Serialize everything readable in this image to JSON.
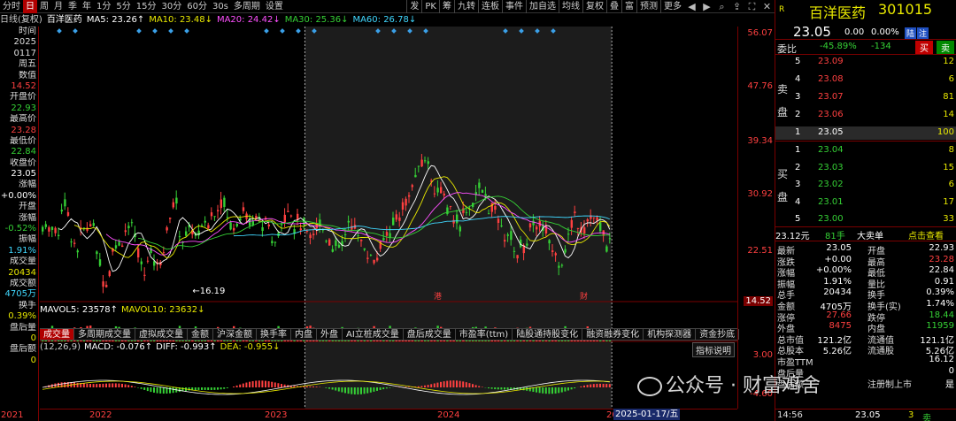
{
  "topbar": {
    "left_items": [
      "分时",
      "日",
      "周",
      "月",
      "季",
      "年",
      "1分",
      "5分",
      "15分",
      "30分",
      "60分",
      "30s",
      "多周期",
      "设置"
    ],
    "active_index": 1,
    "right_items": [
      "发",
      "PK",
      "筹",
      "九转",
      "连板",
      "事件",
      "加自选",
      "均线",
      "复权",
      "叠",
      "富",
      "预测",
      "更多"
    ],
    "icons": [
      "back-icon",
      "forward-icon",
      "search-icon",
      "share-icon",
      "fullscreen-icon",
      "close-icon"
    ]
  },
  "ma_line": [
    {
      "text": "日线(复权)",
      "color": "#cccccc"
    },
    {
      "text": "百洋医药",
      "color": "#ffffff"
    },
    {
      "text": "MA5: 23.26↑",
      "color": "#ffffff"
    },
    {
      "text": "MA10: 23.48↓",
      "color": "#e8e800"
    },
    {
      "text": "MA20: 24.42↓",
      "color": "#ff50ff"
    },
    {
      "text": "MA30: 25.36↓",
      "color": "#35d035"
    },
    {
      "text": "MA60: 26.78↓",
      "color": "#40d8ff"
    }
  ],
  "sidebar": [
    {
      "t": "时间",
      "c": "lbl"
    },
    {
      "t": "2025",
      "c": "lbl"
    },
    {
      "t": "0117",
      "c": "lbl"
    },
    {
      "t": "周五",
      "c": "lbl"
    },
    {
      "t": "数值",
      "c": "lbl"
    },
    {
      "t": "14.52",
      "c": "red"
    },
    {
      "t": "开盘价",
      "c": "lbl"
    },
    {
      "t": "22.93",
      "c": "green"
    },
    {
      "t": "最高价",
      "c": "lbl"
    },
    {
      "t": "23.28",
      "c": "red"
    },
    {
      "t": "最低价",
      "c": "lbl"
    },
    {
      "t": "22.84",
      "c": "green"
    },
    {
      "t": "收盘价",
      "c": "lbl"
    },
    {
      "t": "23.05",
      "c": "wht"
    },
    {
      "t": "涨幅",
      "c": "lbl"
    },
    {
      "t": "+0.00%",
      "c": "wht"
    },
    {
      "t": "开盘",
      "c": "lbl"
    },
    {
      "t": "涨幅",
      "c": "lbl"
    },
    {
      "t": "-0.52%",
      "c": "green"
    },
    {
      "t": "振幅",
      "c": "lbl"
    },
    {
      "t": "1.91%",
      "c": "cyan"
    },
    {
      "t": "成交量",
      "c": "lbl"
    },
    {
      "t": "20434",
      "c": "yel"
    },
    {
      "t": "成交额",
      "c": "lbl"
    },
    {
      "t": "4705万",
      "c": "cyan"
    },
    {
      "t": "换手",
      "c": "lbl"
    },
    {
      "t": "0.39%",
      "c": "yel"
    },
    {
      "t": "盘后量",
      "c": "lbl"
    },
    {
      "t": "0",
      "c": "yel"
    },
    {
      "t": "盘后额",
      "c": "lbl"
    },
    {
      "t": "0",
      "c": "yel"
    },
    {
      "t": "",
      "c": "lbl"
    }
  ],
  "right_axis": [
    "56.07",
    "47.76",
    "39.34",
    "30.92",
    "22.51",
    "14.52"
  ],
  "macd_axis": [
    "3.00",
    "-4.60"
  ],
  "vol_line": [
    {
      "text": "MAVOL5: 23578↑",
      "color": "#ffffff"
    },
    {
      "text": "MAVOL10: 23632↓",
      "color": "#e8e800"
    }
  ],
  "tabs": [
    "成交量",
    "多周期成交量",
    "虚拟成交量",
    "金额",
    "沪深金额",
    "换手率",
    "内盘",
    "外盘",
    "AI立桩成交量",
    "盘后成交量",
    "市盈率(ttm)",
    "陆股通持股变化",
    "融资融券变化",
    "机构探测器",
    "资金抄底"
  ],
  "macd_line": [
    {
      "text": "(12,26,9)",
      "color": "#cccccc"
    },
    {
      "text": "MACD: -0.076↑",
      "color": "#ffffff"
    },
    {
      "text": "DIFF: -0.993↑",
      "color": "#ffffff"
    },
    {
      "text": "DEA: -0.955↓",
      "color": "#e8e800"
    }
  ],
  "macd_button": "指标说明",
  "x_axis": [
    "2021",
    "2022",
    "2023",
    "2024",
    "20"
  ],
  "date_box": "2025-01-17/五",
  "min_label": "16.19",
  "markers": [
    "港",
    "财"
  ],
  "panel": {
    "r_label": "R",
    "name": "百洋医药",
    "code": "301015",
    "price": "23.05",
    "change": "0.00",
    "pct": "0.00%",
    "tag1": "陆",
    "tag2": "注",
    "weibi_label": "委比",
    "weibi": "-45.89%",
    "weicha": "-134",
    "buy_btn": "买",
    "sell_btn": "卖",
    "sell_side": "卖盘",
    "buy_side": "买盘",
    "asks": [
      [
        "5",
        "23.09",
        "12"
      ],
      [
        "4",
        "23.08",
        "6"
      ],
      [
        "3",
        "23.07",
        "81"
      ],
      [
        "2",
        "23.06",
        "14"
      ],
      [
        "1",
        "23.05",
        "100"
      ]
    ],
    "bids": [
      [
        "1",
        "23.04",
        "8"
      ],
      [
        "2",
        "23.03",
        "15"
      ],
      [
        "3",
        "23.02",
        "6"
      ],
      [
        "4",
        "23.01",
        "17"
      ],
      [
        "5",
        "23.00",
        "33"
      ]
    ],
    "deal_line": {
      "price": "23.12元",
      "lots": "81手",
      "label": "大卖单",
      "link": "点击查看"
    },
    "stats": [
      [
        "最新",
        "23.05",
        "开盘",
        "22.93"
      ],
      [
        "涨跌",
        "+0.00",
        "最高",
        "23.28"
      ],
      [
        "涨幅",
        "+0.00%",
        "最低",
        "22.84"
      ],
      [
        "振幅",
        "1.91%",
        "量比",
        "0.91"
      ],
      [
        "总手",
        "20434",
        "换手",
        "0.39%"
      ],
      [
        "金额",
        "4705万",
        "换手(实)",
        "1.74%"
      ],
      [
        "涨停",
        "27.66",
        "跌停",
        "18.44"
      ],
      [
        "外盘",
        "8475",
        "内盘",
        "11959"
      ],
      [
        "总市值",
        "121.2亿",
        "流通值",
        "121.1亿"
      ],
      [
        "总股本",
        "5.26亿",
        "流通股",
        "5.26亿"
      ],
      [
        "市盈TTM",
        "",
        "",
        "16.12"
      ],
      [
        "盘后量",
        "",
        "",
        "0"
      ],
      [
        "盘后额",
        "",
        "注册制上市",
        "是"
      ]
    ],
    "bottom_time": "14:56",
    "bottom_price": "23.05",
    "bottom_vol": "3",
    "bottom_flag": "卖"
  },
  "watermark": "公众号 · 财富鸡舍",
  "colors": {
    "up": "#ff4040",
    "down": "#35d035",
    "axis": "#7a0000",
    "bg": "#000000",
    "highlight": "#1c1c1c"
  },
  "chart_data": {
    "type": "candlestick",
    "x_ticks": [
      "2021",
      "2022",
      "2023",
      "2024",
      "20"
    ],
    "y_ticks": [
      "56.07",
      "47.76",
      "39.34",
      "30.92",
      "22.51",
      "14.52"
    ],
    "ylim": [
      14.52,
      56.07
    ],
    "series_names": [
      "MA5",
      "MA10",
      "MA20",
      "MA30",
      "MA60"
    ],
    "price_path": [
      26,
      27,
      25,
      27,
      24,
      29,
      31,
      26,
      23,
      22,
      26,
      25,
      27,
      28,
      22,
      20,
      18,
      17,
      22,
      24,
      23,
      25,
      26,
      27,
      24,
      22,
      19,
      20,
      22,
      21,
      20,
      22,
      24,
      27,
      30,
      29,
      25,
      24,
      25,
      26,
      25,
      24,
      27,
      26,
      28,
      29,
      30,
      31,
      28,
      26,
      27,
      28,
      29,
      28,
      27,
      26,
      28,
      27,
      26,
      25,
      24,
      25,
      26,
      28,
      30,
      28,
      26,
      27,
      26,
      25,
      24,
      25,
      27,
      26,
      25,
      24,
      23,
      22,
      23,
      25,
      27,
      26,
      25,
      24,
      23,
      22,
      21,
      21,
      22,
      24,
      25,
      26,
      27,
      28,
      29,
      30,
      32,
      33,
      35,
      36,
      37,
      35,
      33,
      32,
      31,
      30,
      29,
      28,
      27,
      27,
      28,
      29,
      30,
      31,
      32,
      31,
      30,
      29,
      28,
      27,
      26,
      25,
      24,
      23,
      22,
      23,
      24,
      25,
      26,
      27,
      26,
      25,
      24,
      23,
      22,
      21,
      22,
      24,
      26,
      28,
      27,
      26,
      27,
      28,
      27,
      26,
      25,
      24,
      23
    ],
    "highlight_range": [
      0.38,
      0.82
    ],
    "min_marker": 16.19
  }
}
